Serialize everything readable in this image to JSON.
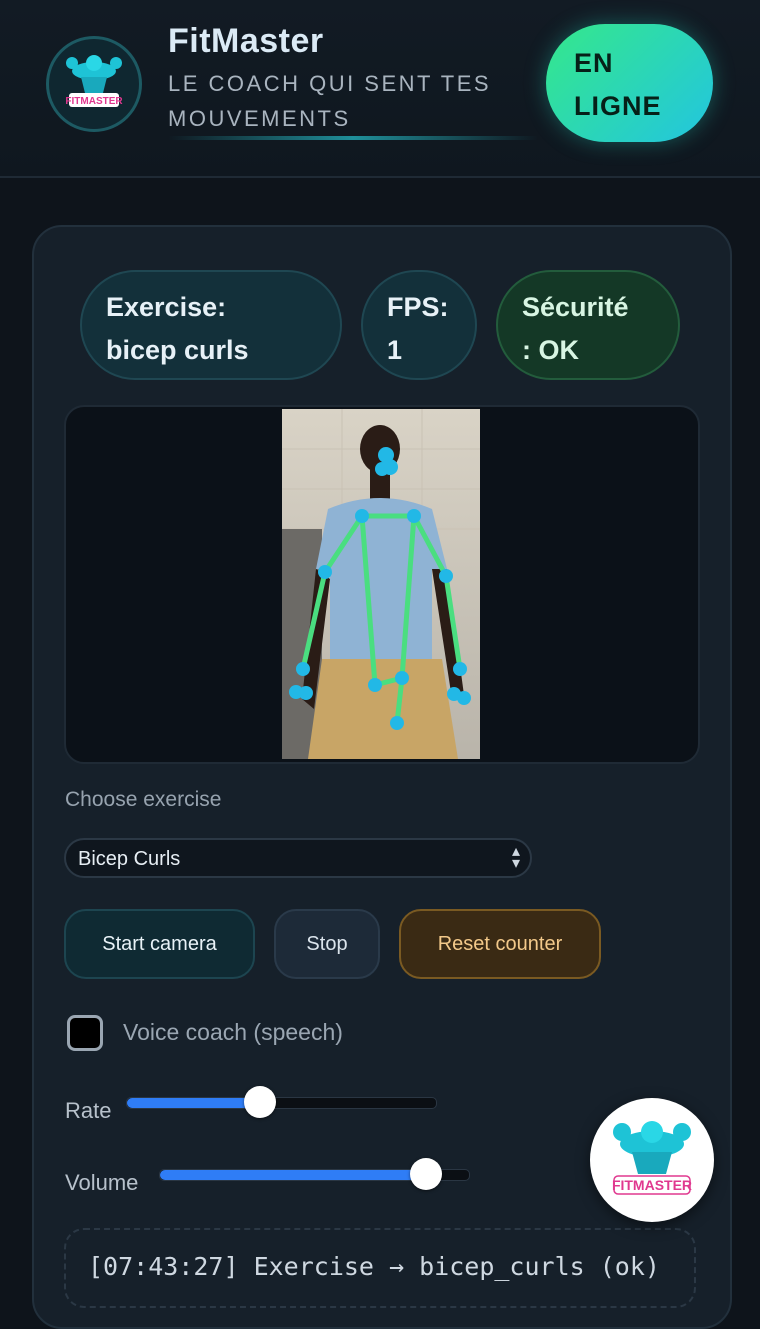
{
  "header": {
    "title": "FitMaster",
    "subtitle": "LE COACH QUI SENT TES MOUVEMENTS",
    "status_line1": "EN",
    "status_line2": "LIGNE",
    "logo_text": "FITMASTER"
  },
  "stats": {
    "exercise_line1": "Exercise:",
    "exercise_line2": "bicep curls",
    "fps_line1": "FPS:",
    "fps_line2": "1",
    "safety_line1": "Sécurité",
    "safety_line2": ": OK"
  },
  "controls": {
    "choose_label": "Choose exercise",
    "selected_exercise": "Bicep Curls",
    "start_label": "Start camera",
    "stop_label": "Stop",
    "reset_label": "Reset counter",
    "voice_label": "Voice coach (speech)",
    "voice_checked": false,
    "rate_label": "Rate",
    "rate_value": 0.43,
    "volume_label": "Volume",
    "volume_value": 0.86
  },
  "log": {
    "line": "[07:43:27] Exercise → bicep_curls (ok)"
  },
  "colors": {
    "accent": "#22c5e0",
    "status_green": "#35e88a",
    "skeleton": "#4ade80",
    "keypoint": "#22b8e6"
  },
  "icons": {
    "logo": "bodybuilder-logo-icon",
    "select": "chevron-updown-icon"
  }
}
